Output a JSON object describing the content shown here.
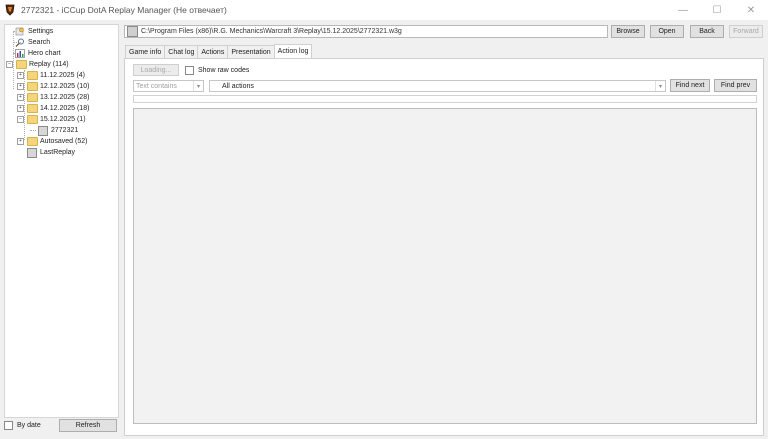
{
  "window": {
    "title": "2772321 - iCCup DotA Replay Manager (Не отвечает)",
    "minimize": "—",
    "maximize": "☐",
    "close": "✕"
  },
  "tree": {
    "settings": "Settings",
    "search": "Search",
    "hero_chart": "Hero chart",
    "replay": "Replay (114)",
    "folders": [
      "11.12.2025 (4)",
      "12.12.2025 (10)",
      "13.12.2025 (28)",
      "14.12.2025 (18)",
      "15.12.2025 (1)"
    ],
    "replay_file": "2772321",
    "autosaved": "Autosaved (52)",
    "last_replay": "LastReplay"
  },
  "bottom_left": {
    "by_date": "By date",
    "refresh": "Refresh"
  },
  "toolbar": {
    "path": "C:\\Program Files (x86)\\R.G. Mechanics\\Warcraft 3\\Replay\\15.12.2025\\2772321.w3g",
    "browse": "Browse",
    "open": "Open",
    "back": "Back",
    "forward": "Forward"
  },
  "tabs": [
    "Game info",
    "Chat log",
    "Actions",
    "Presentation",
    "Action log"
  ],
  "action_log": {
    "loading": "Loading...",
    "show_raw_codes": "Show raw codes",
    "filter_mode": "Text contains",
    "action_filter": "All actions",
    "find_next": "Find next",
    "find_prev": "Find prev"
  }
}
